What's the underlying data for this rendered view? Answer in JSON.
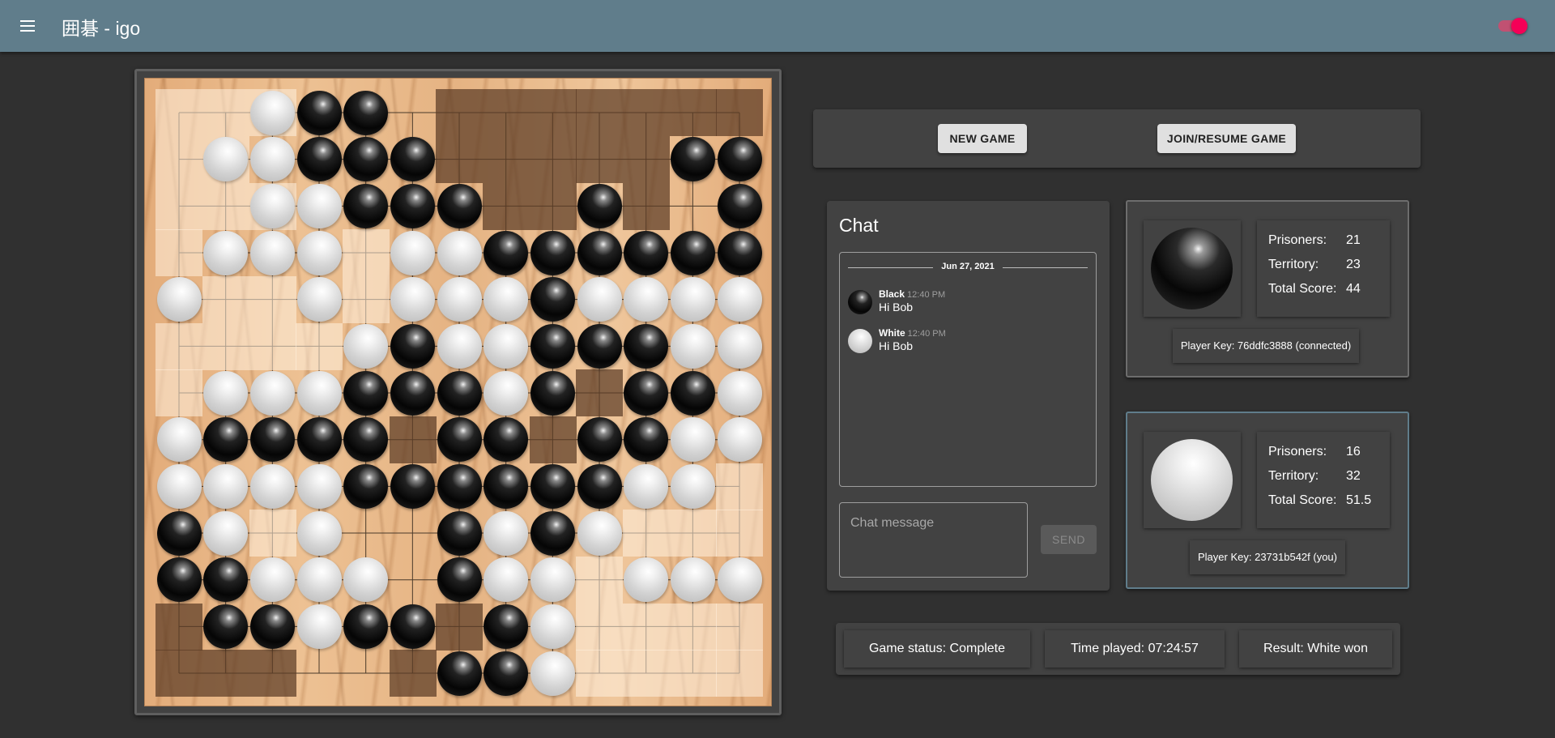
{
  "app": {
    "title": "囲碁 - igo",
    "theme_accent": "#f50057",
    "bar_color": "#607d8b"
  },
  "controls": {
    "new_game_label": "NEW GAME",
    "join_label": "JOIN/RESUME GAME"
  },
  "board": {
    "size": 13,
    "rows": [
      "..WBB........",
      ".WWBBB.....BB",
      "..WWBBB..B..B",
      ".WWW.WWBBBBBB",
      "W..W.WWWBWWWW",
      "....WBWWBBBWW",
      ".WWWBBBWB.BBW",
      "WBBBB.BB.BBWW",
      "WWWWBBBBBBWW.",
      "BW.W..BWBW...",
      "BBWWW.BWW.WWW",
      ".BBWBB.BW....",
      "......BBW...."
    ],
    "territory_black": [
      [
        0,
        6
      ],
      [
        0,
        7
      ],
      [
        0,
        8
      ],
      [
        0,
        9
      ],
      [
        0,
        10
      ],
      [
        0,
        11
      ],
      [
        0,
        12
      ],
      [
        1,
        6
      ],
      [
        1,
        7
      ],
      [
        1,
        8
      ],
      [
        1,
        9
      ],
      [
        1,
        10
      ],
      [
        2,
        7
      ],
      [
        2,
        8
      ],
      [
        2,
        10
      ],
      [
        6,
        9
      ],
      [
        7,
        5
      ],
      [
        7,
        8
      ],
      [
        11,
        0
      ],
      [
        11,
        6
      ],
      [
        12,
        0
      ],
      [
        12,
        1
      ],
      [
        12,
        2
      ],
      [
        12,
        5
      ]
    ],
    "territory_white": [
      [
        0,
        0
      ],
      [
        0,
        1
      ],
      [
        0,
        2
      ],
      [
        1,
        0
      ],
      [
        1,
        1
      ],
      [
        2,
        0
      ],
      [
        2,
        1
      ],
      [
        2,
        2
      ],
      [
        3,
        0
      ],
      [
        3,
        4
      ],
      [
        4,
        1
      ],
      [
        4,
        2
      ],
      [
        4,
        4
      ],
      [
        5,
        0
      ],
      [
        5,
        1
      ],
      [
        5,
        2
      ],
      [
        5,
        3
      ],
      [
        6,
        0
      ],
      [
        8,
        12
      ],
      [
        9,
        2
      ],
      [
        9,
        10
      ],
      [
        9,
        11
      ],
      [
        9,
        12
      ],
      [
        10,
        9
      ],
      [
        11,
        9
      ],
      [
        11,
        10
      ],
      [
        11,
        11
      ],
      [
        11,
        12
      ],
      [
        12,
        9
      ],
      [
        12,
        10
      ],
      [
        12,
        11
      ],
      [
        12,
        12
      ]
    ]
  },
  "chat": {
    "title": "Chat",
    "date": "Jun 27, 2021",
    "messages": [
      {
        "from": "Black",
        "time": "12:40 PM",
        "text": "Hi Bob",
        "color": "black"
      },
      {
        "from": "White",
        "time": "12:40 PM",
        "text": "Hi Bob",
        "color": "white"
      }
    ],
    "input_placeholder": "Chat message",
    "send_label": "SEND"
  },
  "players": [
    {
      "color": "black",
      "prisoners_label": "Prisoners:",
      "prisoners": "21",
      "territory_label": "Territory:",
      "territory": "23",
      "total_label": "Total Score:",
      "total": "44",
      "key_text": "Player Key: 76ddfc3888  (connected)"
    },
    {
      "color": "white",
      "prisoners_label": "Prisoners:",
      "prisoners": "16",
      "territory_label": "Territory:",
      "territory": "32",
      "total_label": "Total Score:",
      "total": "51.5",
      "key_text": "Player Key: 23731b542f  (you)"
    }
  ],
  "status": {
    "game_status": "Game status: Complete",
    "time_played": "Time played: 07:24:57",
    "result": "Result: White won"
  }
}
